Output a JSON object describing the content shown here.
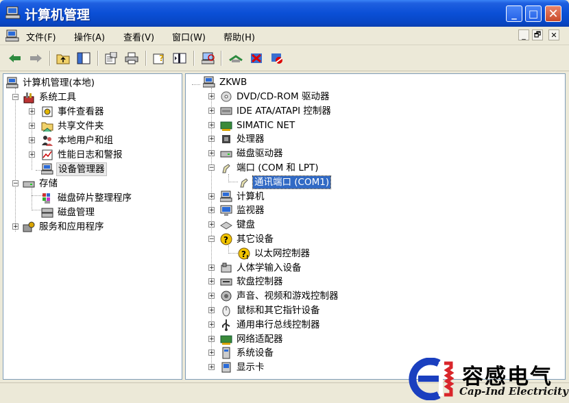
{
  "window": {
    "title": "计算机管理"
  },
  "menubar": {
    "items": [
      "文件(F)",
      "操作(A)",
      "查看(V)",
      "窗口(W)",
      "帮助(H)"
    ]
  },
  "title_controls": [
    "_",
    "□",
    "✕"
  ],
  "mdi_controls": [
    "_",
    "🗗",
    "✕"
  ],
  "toolbar": {
    "icons": [
      "back-arrow-icon",
      "forward-arrow-icon",
      "up-folder-icon",
      "show-hide-tree-icon",
      "properties-icon",
      "print-icon",
      "help-icon",
      "console-icon",
      "scan-hardware-icon",
      "update-driver-icon",
      "uninstall-icon",
      "disable-icon"
    ]
  },
  "left_tree": {
    "root": "计算机管理(本地)",
    "items": [
      {
        "label": "系统工具",
        "level": 1,
        "expand": "−",
        "icon": "tools-icon"
      },
      {
        "label": "事件查看器",
        "level": 2,
        "expand": "+",
        "icon": "event-viewer-icon"
      },
      {
        "label": "共享文件夹",
        "level": 2,
        "expand": "+",
        "icon": "shared-folder-icon"
      },
      {
        "label": "本地用户和组",
        "level": 2,
        "expand": "+",
        "icon": "users-icon"
      },
      {
        "label": "性能日志和警报",
        "level": 2,
        "expand": "+",
        "icon": "performance-icon"
      },
      {
        "label": "设备管理器",
        "level": 2,
        "expand": "",
        "icon": "device-manager-icon",
        "selected_box": true
      },
      {
        "label": "存储",
        "level": 1,
        "expand": "−",
        "icon": "storage-icon"
      },
      {
        "label": "磁盘碎片整理程序",
        "level": 2,
        "expand": "",
        "icon": "defrag-icon"
      },
      {
        "label": "磁盘管理",
        "level": 2,
        "expand": "",
        "icon": "disk-management-icon"
      },
      {
        "label": "服务和应用程序",
        "level": 1,
        "expand": "+",
        "icon": "services-icon"
      }
    ]
  },
  "right_tree": {
    "root": "ZKWB",
    "items": [
      {
        "label": "DVD/CD-ROM 驱动器",
        "level": 1,
        "expand": "+",
        "icon": "cdrom-icon"
      },
      {
        "label": "IDE ATA/ATAPI 控制器",
        "level": 1,
        "expand": "+",
        "icon": "ide-controller-icon"
      },
      {
        "label": "SIMATIC NET",
        "level": 1,
        "expand": "+",
        "icon": "network-card-icon"
      },
      {
        "label": "处理器",
        "level": 1,
        "expand": "+",
        "icon": "processor-icon"
      },
      {
        "label": "磁盘驱动器",
        "level": 1,
        "expand": "+",
        "icon": "disk-drive-icon"
      },
      {
        "label": "端口 (COM 和 LPT)",
        "level": 1,
        "expand": "−",
        "icon": "port-icon"
      },
      {
        "label": "通讯端口 (COM1)",
        "level": 2,
        "expand": "",
        "icon": "port-icon",
        "selected": true
      },
      {
        "label": "计算机",
        "level": 1,
        "expand": "+",
        "icon": "computer-icon"
      },
      {
        "label": "监视器",
        "level": 1,
        "expand": "+",
        "icon": "monitor-icon"
      },
      {
        "label": "键盘",
        "level": 1,
        "expand": "+",
        "icon": "keyboard-icon"
      },
      {
        "label": "其它设备",
        "level": 1,
        "expand": "−",
        "icon": "unknown-device-icon"
      },
      {
        "label": "以太网控制器",
        "level": 2,
        "expand": "",
        "icon": "warning-device-icon"
      },
      {
        "label": "人体学输入设备",
        "level": 1,
        "expand": "+",
        "icon": "hid-icon"
      },
      {
        "label": "软盘控制器",
        "level": 1,
        "expand": "+",
        "icon": "floppy-controller-icon"
      },
      {
        "label": "声音、视频和游戏控制器",
        "level": 1,
        "expand": "+",
        "icon": "sound-icon"
      },
      {
        "label": "鼠标和其它指针设备",
        "level": 1,
        "expand": "+",
        "icon": "mouse-icon"
      },
      {
        "label": "通用串行总线控制器",
        "level": 1,
        "expand": "+",
        "icon": "usb-icon"
      },
      {
        "label": "网络适配器",
        "level": 1,
        "expand": "+",
        "icon": "network-adapter-icon"
      },
      {
        "label": "系统设备",
        "level": 1,
        "expand": "+",
        "icon": "system-device-icon"
      },
      {
        "label": "显示卡",
        "level": 1,
        "expand": "+",
        "icon": "display-adapter-icon"
      }
    ]
  },
  "watermark": {
    "cn": "容感电气",
    "en": "Cap-Ind Electricity"
  },
  "colors": {
    "title_blue": "#0a4fd6",
    "selection": "#316ac5",
    "chrome": "#ece9d8",
    "logo_blue": "#1a3fbf",
    "logo_red": "#d9262b"
  }
}
